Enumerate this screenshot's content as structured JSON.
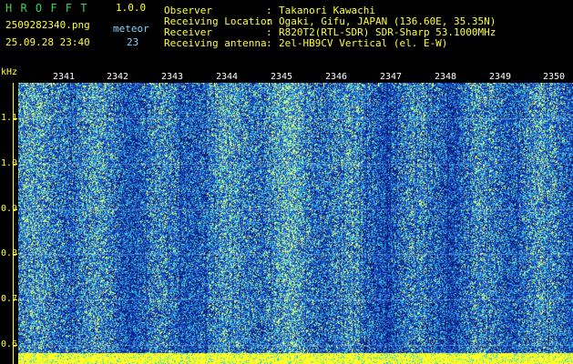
{
  "header": {
    "app_name": "H R O F F T",
    "version": "1.0.0",
    "filename": "2509282340.png",
    "mode_label": "meteor",
    "datetime": "25.09.28 23:40",
    "count": "23",
    "fields": [
      {
        "label": "Observer",
        "value": "Takanori Kawachi"
      },
      {
        "label": "Receiving Location",
        "value": "Ogaki, Gifu, JAPAN (136.60E, 35.35N)"
      },
      {
        "label": "Receiver",
        "value": "R820T2(RTL-SDR) SDR-Sharp 53.1000MHz"
      },
      {
        "label": "Receiving antenna",
        "value": "2el-HB9CV Vertical (el. E-W)"
      }
    ]
  },
  "axes": {
    "y_unit": "kHz",
    "y_ticks": [
      "1.1",
      "1.0",
      "0.9",
      "0.8",
      "0.7",
      "0.6"
    ],
    "x_ticks": [
      "2341",
      "2342",
      "2343",
      "2344",
      "2345",
      "2346",
      "2347",
      "2348",
      "2349",
      "2350"
    ]
  },
  "colors": {
    "background": "#000000",
    "noise_low": "#0a1a8a",
    "noise_mid": "#2a6bd8",
    "noise_high": "#30e0e0",
    "signal": "#ffff33",
    "label_green": "#39d353",
    "label_yellow": "#ffff33"
  }
}
